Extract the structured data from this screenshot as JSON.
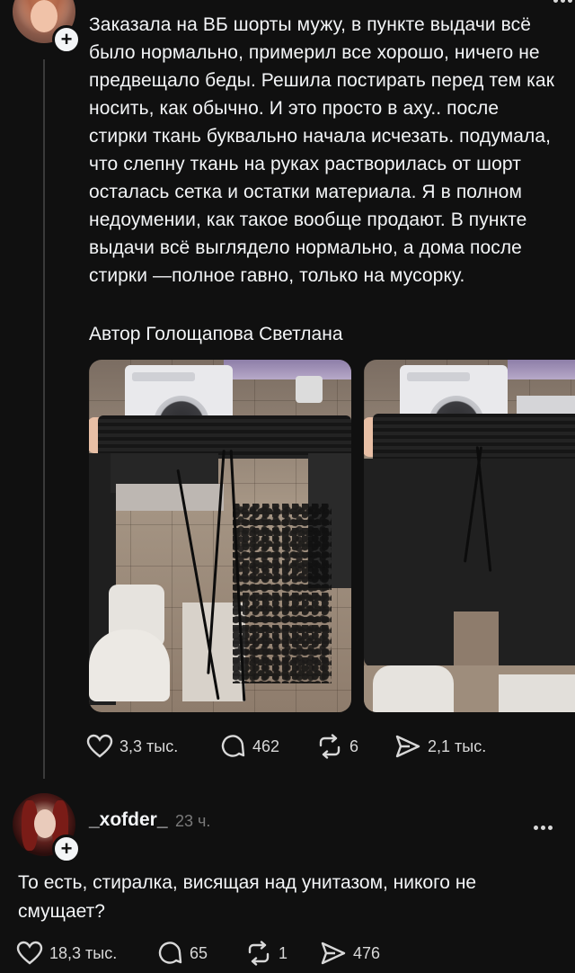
{
  "post": {
    "text": "Заказала на ВБ шорты мужу, в пункте выдачи всё было нормально, примерил все хорошо, ничего не предвещало беды. Решила постирать перед тем как носить, как обычно. И это просто в аху.. после стирки ткань буквально начала исчезать. подумала, что слепну ткань на руках растворилась от шорт осталась сетка и остатки материала. Я в полном недоумении, как такое вообще продают. В пункте выдачи всё выглядело нормально, а дома после стирки —полное гавно, только на мусорку.",
    "author_line": "Автор Голощапова Светлана",
    "likes": "3,3 тыс.",
    "comments": "462",
    "reposts": "6",
    "shares": "2,1 тыс."
  },
  "reply": {
    "username": "_xofder_",
    "time": "23 ч.",
    "text": "То есть, стиралка, висящая над унитазом, никого не смущает?",
    "likes": "18,3 тыс.",
    "comments": "65",
    "reposts": "1",
    "shares": "476"
  },
  "icons": {
    "like": "heart-icon",
    "comment": "comment-bubble-icon",
    "repost": "repost-icon",
    "share": "send-icon",
    "follow": "plus-icon",
    "more": "more-dots-icon"
  },
  "colors": {
    "background": "#101010",
    "text": "#f3f5f7",
    "muted": "#7a7a7a",
    "thread_line": "#3a3a3a"
  }
}
